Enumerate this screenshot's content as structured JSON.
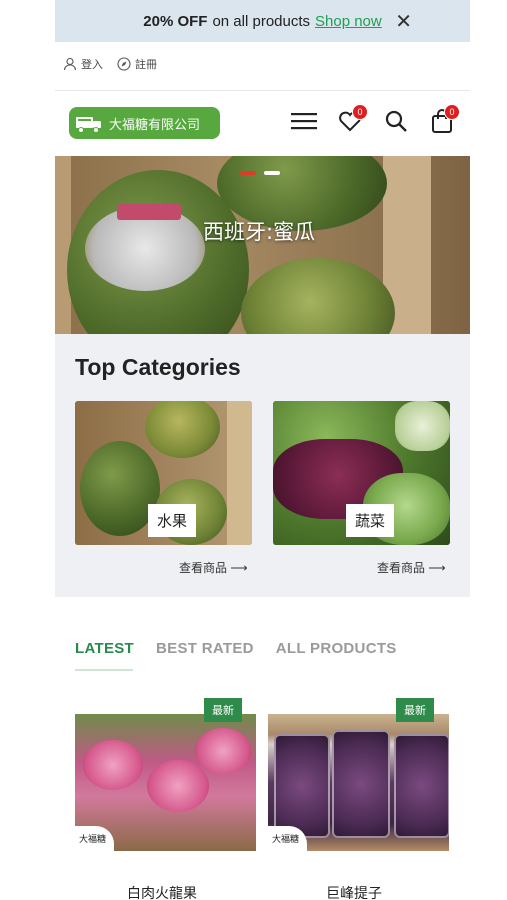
{
  "promo": {
    "discount": "20% OFF",
    "rest": "on all products",
    "link": "Shop now",
    "close": "✕"
  },
  "auth": {
    "login": "登入",
    "register": "註冊"
  },
  "logo": {
    "text": "大福糖有限公司"
  },
  "header": {
    "wishlist_count": "0",
    "cart_count": "0"
  },
  "hero": {
    "caption": "西班牙:蜜瓜"
  },
  "categories": {
    "title": "Top Categories",
    "items": [
      {
        "label": "水果",
        "link": "查看商品 ⟶"
      },
      {
        "label": "蔬菜",
        "link": "查看商品 ⟶"
      }
    ]
  },
  "tabs": [
    "LATEST",
    "BEST RATED",
    "ALL PRODUCTS"
  ],
  "products": [
    {
      "tag": "最新",
      "vendor": "大福糖",
      "name": "白肉火龍果"
    },
    {
      "tag": "最新",
      "vendor": "大福糖",
      "name": "巨峰提子"
    }
  ],
  "colors": {
    "accent": "#2a8a4d",
    "promo_bg": "#dbe5ee",
    "badge": "#e01e1e",
    "logo_bg": "#57a83e"
  }
}
